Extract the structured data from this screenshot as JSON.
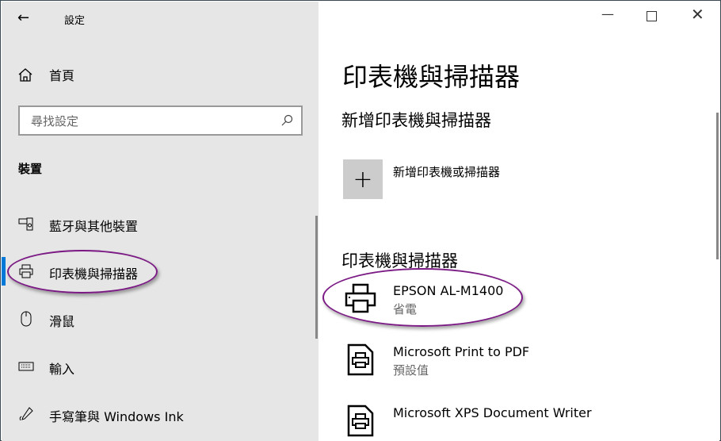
{
  "app_title": "設定",
  "home": "首頁",
  "search": {
    "placeholder": "尋找設定"
  },
  "section": "裝置",
  "nav": [
    {
      "label": "藍牙與其他裝置",
      "icon": "bluetooth-devices-icon"
    },
    {
      "label": "印表機與掃描器",
      "icon": "printer-icon",
      "selected": true
    },
    {
      "label": "滑鼠",
      "icon": "mouse-icon"
    },
    {
      "label": "輸入",
      "icon": "keyboard-icon"
    },
    {
      "label": "手寫筆與 Windows Ink",
      "icon": "pen-icon"
    }
  ],
  "main": {
    "title": "印表機與掃描器",
    "add_heading": "新增印表機與掃描器",
    "add_label": "新增印表機或掃描器",
    "list_heading": "印表機與掃描器",
    "printers": [
      {
        "name": "EPSON AL-M1400",
        "status": "省電"
      },
      {
        "name": "Microsoft Print to PDF",
        "status": "預設值"
      },
      {
        "name": "Microsoft XPS Document Writer",
        "status": ""
      }
    ]
  },
  "colors": {
    "accent": "#0078d7",
    "annotation": "#7b1a84"
  }
}
